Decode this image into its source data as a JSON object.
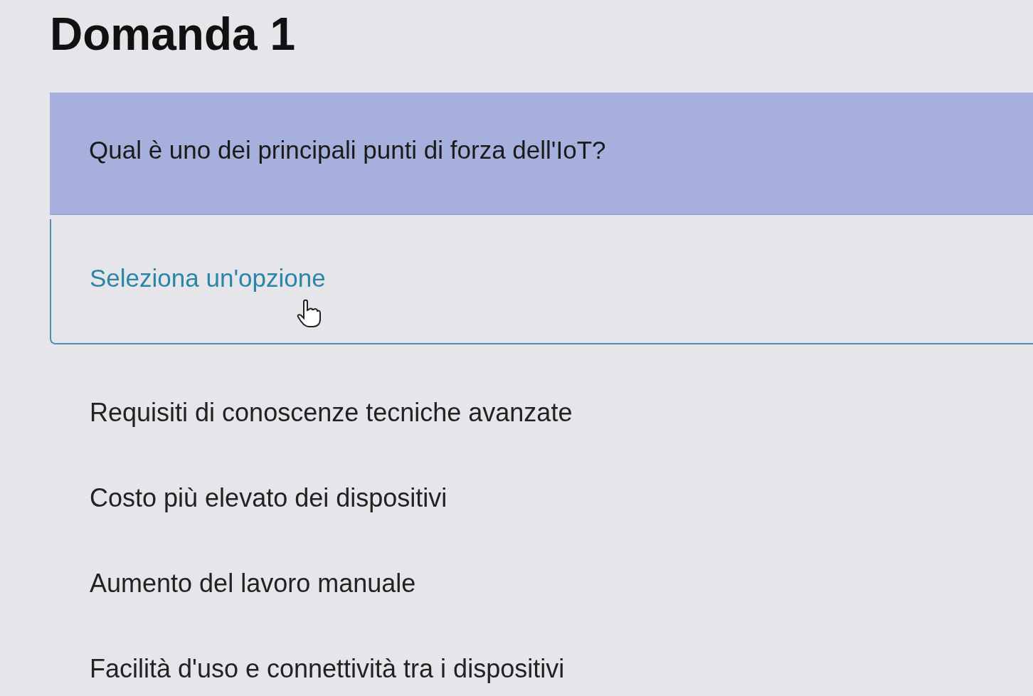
{
  "title": "Domanda 1",
  "question": "Qual è uno dei principali punti di forza dell'IoT?",
  "select": {
    "placeholder": "Seleziona un'opzione"
  },
  "options": [
    {
      "label": "Requisiti di conoscenze tecniche avanzate",
      "selected": false
    },
    {
      "label": "Costo più elevato dei dispositivi",
      "selected": false
    },
    {
      "label": "Aumento del lavoro manuale",
      "selected": false
    },
    {
      "label": "Facilità d'uso e connettività tra i dispositivi",
      "selected": false
    }
  ]
}
